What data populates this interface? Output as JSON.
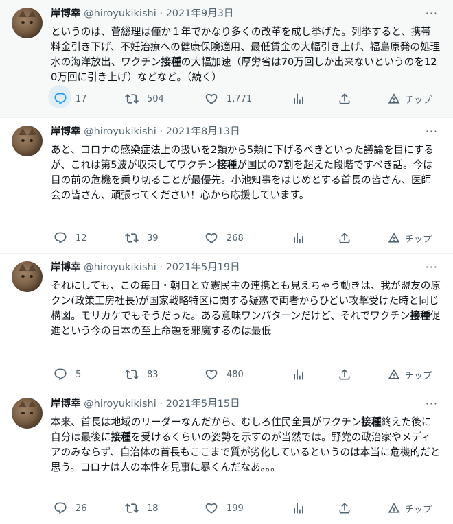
{
  "tweets": [
    {
      "name": "岸博幸",
      "handle": "@hiroyukikishi",
      "separator": "·",
      "date": "2021年9月3日",
      "body": [
        {
          "t": "というのは、菅総理は僅か１年でかなり多くの改革を成し挙げた。列挙すると、携帯料金引き下げ、不妊治療への健康保険適用、最低賃金の大幅引き上げ、福島原発の処理水の海洋放出、ワクチン"
        },
        {
          "t": "接種",
          "b": true
        },
        {
          "t": "の大幅加速（厚労省は70万回しか出来ないというのを120万回に引き上げ）などなど。（続く）"
        }
      ],
      "replies": "17",
      "retweets": "504",
      "likes": "1,771",
      "tip": "チップ"
    },
    {
      "name": "岸博幸",
      "handle": "@hiroyukikishi",
      "separator": "·",
      "date": "2021年8月13日",
      "body": [
        {
          "t": "あと、コロナの感染症法上の扱いを2類から5類に下げるべきといった議論を目にするが、これは第5波が収束してワクチン"
        },
        {
          "t": "接種",
          "b": true
        },
        {
          "t": "が国民の7割を超えた段階ですべき話。今は目の前の危機を乗り切ることが最優先。小池知事をはじめとする首長の皆さん、医師会の皆さん、頑張ってください！心から応援しています。"
        }
      ],
      "replies": "12",
      "retweets": "39",
      "likes": "268",
      "tip": "チップ"
    },
    {
      "name": "岸博幸",
      "handle": "@hiroyukikishi",
      "separator": "·",
      "date": "2021年5月19日",
      "body": [
        {
          "t": "それにしても、この毎日・朝日と立憲民主の連携とも見えちゃう動きは、我が盟友の原クン(政策工房社長)が国家戦略特区に関する疑惑で両者からひどい攻撃受けた時と同じ構図。モリカケでもそうだった。ある意味ワンパターンだけど、それでワクチン"
        },
        {
          "t": "接種",
          "b": true
        },
        {
          "t": "促進という今の日本の至上命題を邪魔するのは最低"
        }
      ],
      "replies": "5",
      "retweets": "83",
      "likes": "480",
      "tip": "チップ"
    },
    {
      "name": "岸博幸",
      "handle": "@hiroyukikishi",
      "separator": "·",
      "date": "2021年5月15日",
      "body": [
        {
          "t": "本来、首長は地域のリーダーなんだから、むしろ住民全員がワクチン"
        },
        {
          "t": "接種",
          "b": true
        },
        {
          "t": "終えた後に自分は最後に"
        },
        {
          "t": "接種",
          "b": true
        },
        {
          "t": "を受けるくらいの姿勢を示すのが当然では。野党の政治家やメディアのみならず、自治体の首長もここまで質が劣化しているというのは本当に危機的だと思う。コロナは人の本性を見事に暴くんだなあ。。。"
        }
      ],
      "replies": "26",
      "retweets": "18",
      "likes": "199",
      "tip": "チップ"
    }
  ],
  "icons": {
    "more": "more-dots-icon",
    "reply": "reply-icon",
    "retweet": "retweet-icon",
    "like": "heart-icon",
    "analytics": "analytics-icon",
    "share": "share-icon",
    "tip": "tip-icon"
  },
  "colors": {
    "text": "#0f1419",
    "secondary": "#536471",
    "accent": "#1d9bf0",
    "highlight_bg": "#f7f9f9"
  }
}
